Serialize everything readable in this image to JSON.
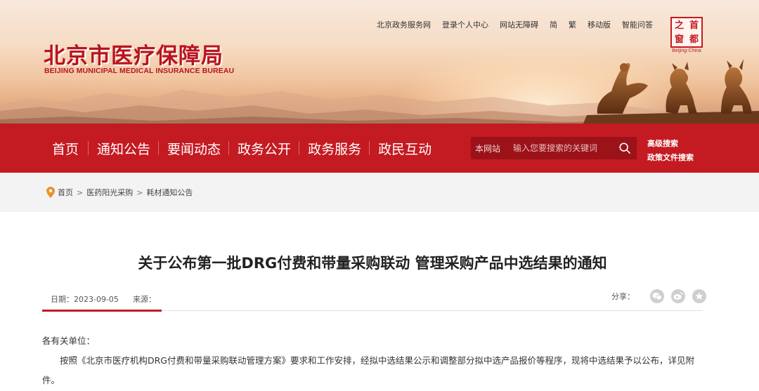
{
  "header": {
    "title_cn": "北京市医疗保障局",
    "title_en": "BEIJING MUNICIPAL MEDICAL INSURANCE BUREAU",
    "top_links": [
      "北京政务服务网",
      "登录个人中心",
      "网站无障碍",
      "简",
      "繁",
      "移动版",
      "智能问答"
    ],
    "seal": {
      "chars": [
        "首",
        "之",
        "都",
        "窗"
      ],
      "en": "Beijing-China"
    }
  },
  "nav": {
    "items": [
      "首页",
      "通知公告",
      "要闻动态",
      "政务公开",
      "政务服务",
      "政民互动"
    ],
    "search_scope": "本网站",
    "search_placeholder": "输入您要搜索的关键词",
    "advanced_search": "高级搜索",
    "policy_search": "政策文件搜索"
  },
  "breadcrumb": {
    "items": [
      "首页",
      "医药阳光采购",
      "耗材通知公告"
    ],
    "separator": ">"
  },
  "article": {
    "title": "关于公布第一批DRG付费和带量采购联动 管理采购产品中选结果的通知",
    "date": "日期：2023-09-05",
    "source": "来源：",
    "share_label": "分享：",
    "salutation": "各有关单位：",
    "paragraph1": "按照《北京市医疗机构DRG付费和带量采购联动管理方案》要求和工作安排，经拟中选结果公示和调整部分拟中选产品报价等程序，现将中选结果予以公布，详见附件。"
  },
  "colors": {
    "brand_red": "#c41a22",
    "search_bg": "#9b1219",
    "crumb_bg": "#f3f3f3"
  }
}
